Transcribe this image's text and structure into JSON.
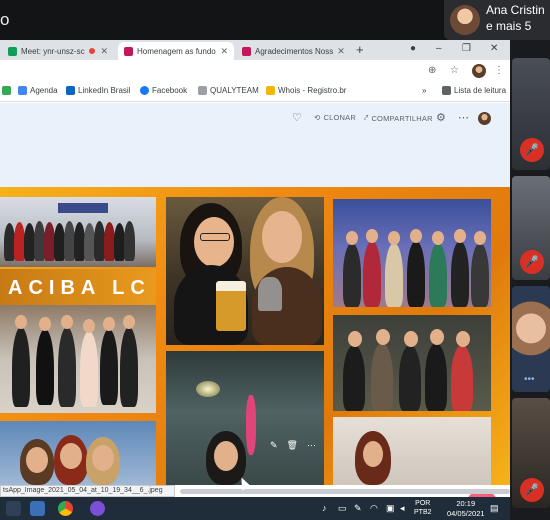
{
  "meet": {
    "left_text": "o",
    "participant_name_line1": "Ana Cristin",
    "participant_name_line2": "e mais 5"
  },
  "browser": {
    "tabs": [
      {
        "label": "Meet: ynr-unsz-sc",
        "favicon_color": "#0f9d58",
        "recording": true
      },
      {
        "label": "Homenagem as fundo",
        "favicon_color": "#c2185b",
        "active": true
      },
      {
        "label": "Agradecimentos Noss",
        "favicon_color": "#c2185b"
      }
    ],
    "new_tab": "+",
    "window_controls": {
      "minimize": "–",
      "restore": "❐",
      "close": "✕"
    },
    "bookmarks": [
      {
        "label": "",
        "icon_color": "#34a853"
      },
      {
        "label": "Agenda",
        "icon_color": "#4285f4"
      },
      {
        "label": "LinkedIn Brasil",
        "icon_color": "#0a66c2"
      },
      {
        "label": "Facebook",
        "icon_color": "#1877f2"
      },
      {
        "label": "QUALYTEAM",
        "icon_color": "#9aa0a6"
      },
      {
        "label": "Whois - Registro.br",
        "icon_color": "#f2b705"
      }
    ],
    "bookmarks_more": "»",
    "reading_list": "Lista de leitura",
    "status_text": "tsApp_Image_2021_05_04_at_10_19_34__6_.jpeg"
  },
  "photos": {
    "clone_label": "CLONAR",
    "share_label": "COMPARTILHAR",
    "fab_label": "+",
    "collage_text": "ACIBA LC",
    "accent_colors": {
      "frame_orange": "#f08a12",
      "frame_gold": "#f6b21a",
      "fab_pink": "#f75f7a"
    }
  },
  "taskbar": {
    "language_line1": "POR",
    "language_line2": "PTB2",
    "time": "20:19",
    "date": "04/05/2021"
  }
}
